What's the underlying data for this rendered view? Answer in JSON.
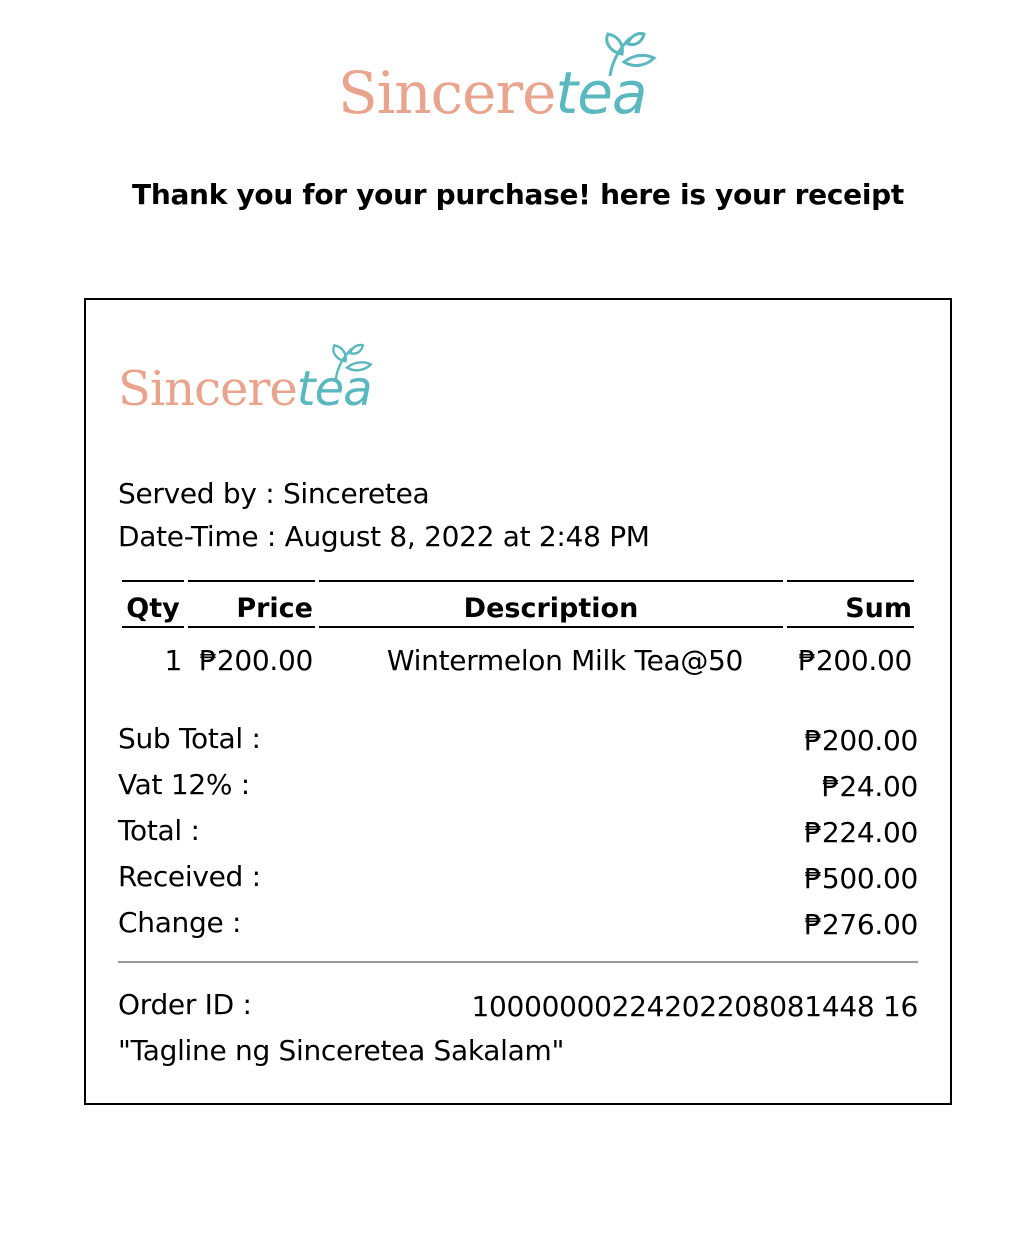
{
  "brand": {
    "name_part1": "Sincere",
    "name_part2": "tea",
    "colors": {
      "sincere": "#e9a48e",
      "tea": "#5ab8be"
    }
  },
  "heading": "Thank you for your purchase! here is your receipt",
  "receipt": {
    "served_by": "Served by : Sinceretea",
    "date_time": "Date-Time : August 8, 2022 at 2:48 PM",
    "columns": {
      "qty": "Qty",
      "price": "Price",
      "description": "Description",
      "sum": "Sum"
    },
    "items": [
      {
        "qty": "1",
        "price": "₱200.00",
        "description": "Wintermelon Milk Tea@50",
        "sum": "₱200.00"
      }
    ],
    "totals": [
      {
        "label": "Sub Total :",
        "value": "₱200.00"
      },
      {
        "label": "Vat 12% :",
        "value": "₱24.00"
      },
      {
        "label": "Total :",
        "value": "₱224.00"
      },
      {
        "label": "Received :",
        "value": "₱500.00"
      },
      {
        "label": "Change :",
        "value": "₱276.00"
      }
    ],
    "order_id_label": "Order ID :",
    "order_id": "10000000224202208081448 16",
    "tagline": "\"Tagline ng Sinceretea Sakalam\""
  }
}
